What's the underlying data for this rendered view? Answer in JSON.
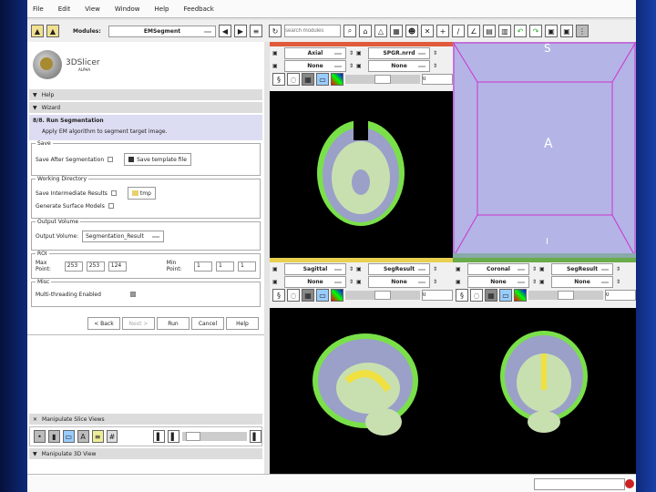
{
  "menu": [
    "File",
    "Edit",
    "View",
    "Window",
    "Help",
    "Feedback"
  ],
  "toolbar": {
    "modules_label": "Modules:",
    "module_value": "EMSegment",
    "search_placeholder": "search modules"
  },
  "logo": {
    "name": "3DSlicer",
    "version": "ALPHA"
  },
  "panel": {
    "help": "Help",
    "wizard": "Wizard",
    "step_title": "8/8. Run Segmentation",
    "step_desc": "Apply EM algorithm to segment target image.",
    "save": {
      "title": "Save",
      "label": "Save After Segmentation",
      "button": "Save template file"
    },
    "workdir": {
      "title": "Working Directory",
      "save_intermediate": "Save Intermediate Results",
      "dir_button": "tmp",
      "surface": "Generate Surface Models"
    },
    "output": {
      "title": "Output Volume",
      "label": "Output Volume:",
      "value": "Segmentation_Result"
    },
    "roi": {
      "title": "ROI",
      "max_label": "Max Point:",
      "max": [
        "253",
        "253",
        "124"
      ],
      "min_label": "Min Point:",
      "min": [
        "1",
        "1",
        "1"
      ]
    },
    "misc": {
      "title": "Misc",
      "multithread": "Multi-threading Enabled"
    },
    "buttons": [
      "< Back",
      "Next >",
      "Run",
      "Cancel",
      "Help"
    ],
    "slice_views": "Manipulate Slice Views",
    "view3d": "Manipulate 3D View"
  },
  "views": {
    "red": {
      "orient": "Axial",
      "bg": "SPGR.nrrd",
      "fg": "None",
      "lbl": "None",
      "offset": "0",
      "color": "#e05a3c"
    },
    "yellow": {
      "orient": "Sagittal",
      "bg": "SegResult",
      "fg": "None",
      "lbl": "None",
      "offset": "0",
      "color": "#e8d050"
    },
    "green": {
      "orient": "Coronal",
      "bg": "SegResult",
      "fg": "None",
      "lbl": "None",
      "offset": "0",
      "color": "#6aab4a"
    },
    "three_d": {
      "top": "S",
      "center": "A",
      "bottom": "I",
      "bg": "#b4b4e6",
      "box": "#cc33cc"
    }
  }
}
